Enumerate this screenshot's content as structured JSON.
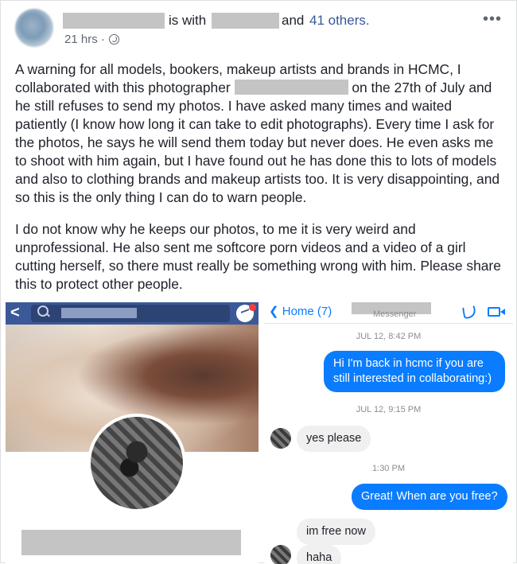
{
  "header": {
    "is_with": "is with",
    "and": "and",
    "others": "41 others.",
    "timestamp": "21 hrs ·",
    "more": "•••"
  },
  "post": {
    "p1_a": "A warning for all models, bookers, makeup artists and brands in HCMC, I collaborated with this photographer ",
    "p1_b": " on the 27th of July and he still refuses to send my photos. I have asked many times and waited patiently (I know how long it can take to edit photographs). Every time I ask for the photos, he says he will send them today but never does. He even asks me to shoot with him again, but I have found out he has done this to lots of models and also to clothing brands and makeup artists too. It is very disappointing, and so this is the only thing I can do to warn people.",
    "p2": "I do not know why he keeps our photos, to me it is very weird and unprofessional. He also sent me softcore porn videos and a video of a girl cutting herself, so there must really be something wrong with him. Please share this to protect other people."
  },
  "left_shot": {
    "back": "<"
  },
  "messenger": {
    "home": "❮ Home (7)",
    "subtitle": "Messenger",
    "time1": "JUL 12, 8:42 PM",
    "msg1": "Hi I'm back in hcmc if you are still interested in collaborating:)",
    "time2": "JUL 12, 9:15 PM",
    "msg2": "yes please",
    "time3": "1:30 PM",
    "msg3": "Great! When are you free?",
    "msg4": "im free now",
    "msg5": "haha"
  }
}
